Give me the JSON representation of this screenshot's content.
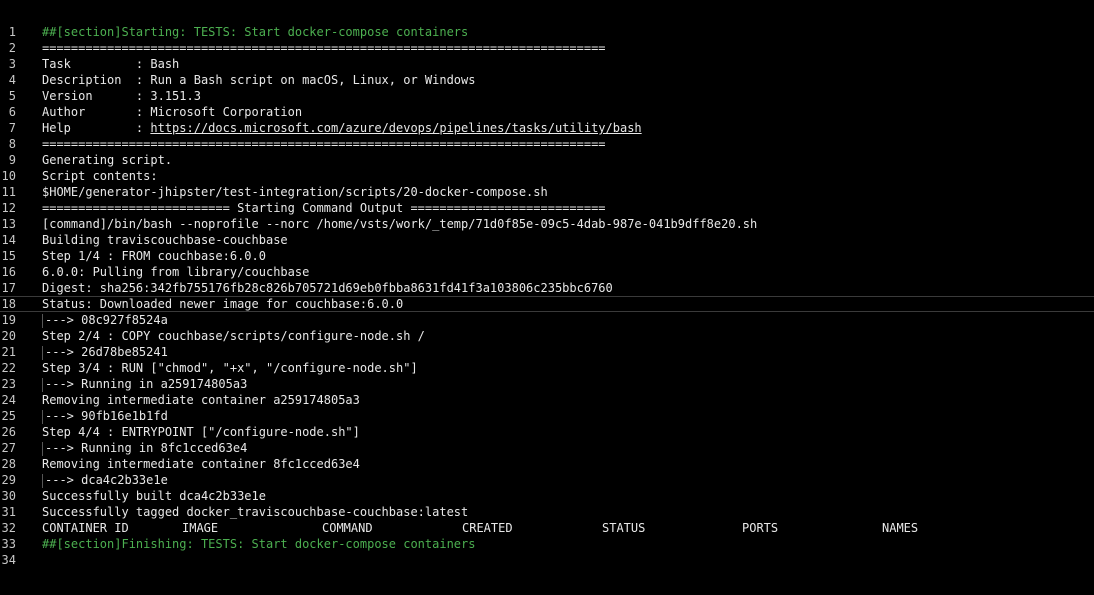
{
  "lines": [
    {
      "n": "1",
      "text": "##[section]Starting: TESTS: Start docker-compose containers",
      "kind": "section"
    },
    {
      "n": "2",
      "text": "=============================================================================="
    },
    {
      "n": "3",
      "text": "Task         : Bash"
    },
    {
      "n": "4",
      "text": "Description  : Run a Bash script on macOS, Linux, or Windows"
    },
    {
      "n": "5",
      "text": "Version      : 3.151.3"
    },
    {
      "n": "6",
      "text": "Author       : Microsoft Corporation"
    },
    {
      "n": "7",
      "prefix": "Help         : ",
      "link": "https://docs.microsoft.com/azure/devops/pipelines/tasks/utility/bash"
    },
    {
      "n": "8",
      "text": "=============================================================================="
    },
    {
      "n": "9",
      "text": "Generating script."
    },
    {
      "n": "10",
      "text": "Script contents:"
    },
    {
      "n": "11",
      "text": "$HOME/generator-jhipster/test-integration/scripts/20-docker-compose.sh"
    },
    {
      "n": "12",
      "text": "========================== Starting Command Output ==========================="
    },
    {
      "n": "13",
      "text": "[command]/bin/bash --noprofile --norc /home/vsts/work/_temp/71d0f85e-09c5-4dab-987e-041b9dff8e20.sh"
    },
    {
      "n": "14",
      "text": "Building traviscouchbase-couchbase"
    },
    {
      "n": "15",
      "text": "Step 1/4 : FROM couchbase:6.0.0"
    },
    {
      "n": "16",
      "text": "6.0.0: Pulling from library/couchbase"
    },
    {
      "n": "17",
      "text": "Digest: sha256:342fb755176fb28c826b705721d69eb0fbba8631fd41f3a103806c235bbc6760"
    },
    {
      "n": "18",
      "text": "Status: Downloaded newer image for couchbase:6.0.0",
      "kind": "highlighted"
    },
    {
      "n": "19",
      "text": "---> 08c927f8524a",
      "kind": "arrow"
    },
    {
      "n": "20",
      "text": "Step 2/4 : COPY couchbase/scripts/configure-node.sh /"
    },
    {
      "n": "21",
      "text": "---> 26d78be85241",
      "kind": "arrow"
    },
    {
      "n": "22",
      "text": "Step 3/4 : RUN [\"chmod\", \"+x\", \"/configure-node.sh\"]"
    },
    {
      "n": "23",
      "text": "---> Running in a259174805a3",
      "kind": "arrow"
    },
    {
      "n": "24",
      "text": "Removing intermediate container a259174805a3"
    },
    {
      "n": "25",
      "text": "---> 90fb16e1b1fd",
      "kind": "arrow"
    },
    {
      "n": "26",
      "text": "Step 4/4 : ENTRYPOINT [\"/configure-node.sh\"]"
    },
    {
      "n": "27",
      "text": "---> Running in 8fc1cced63e4",
      "kind": "arrow"
    },
    {
      "n": "28",
      "text": "Removing intermediate container 8fc1cced63e4"
    },
    {
      "n": "29",
      "text": "---> dca4c2b33e1e",
      "kind": "arrow"
    },
    {
      "n": "30",
      "text": "Successfully built dca4c2b33e1e"
    },
    {
      "n": "31",
      "text": "Successfully tagged docker_traviscouchbase-couchbase:latest"
    },
    {
      "n": "32",
      "kind": "columns",
      "columns": [
        "CONTAINER ID",
        "IMAGE",
        "COMMAND",
        "CREATED",
        "STATUS",
        "PORTS",
        "NAMES"
      ]
    },
    {
      "n": "33",
      "text": "##[section]Finishing: TESTS: Start docker-compose containers",
      "kind": "section"
    },
    {
      "n": "34",
      "text": ""
    }
  ]
}
